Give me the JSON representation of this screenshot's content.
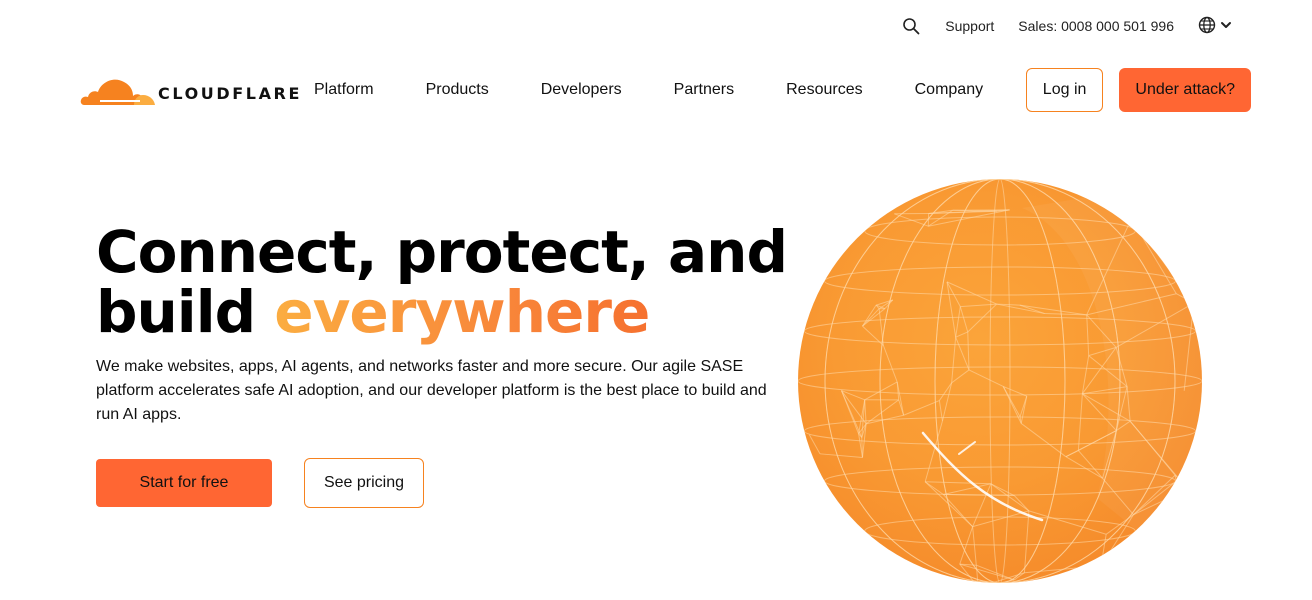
{
  "utility": {
    "search_icon": "search-icon",
    "support": "Support",
    "sales": "Sales: 0008 000 501 996",
    "language_icon": "globe-icon"
  },
  "brand": {
    "name": "CLOUDFLARE",
    "colors": {
      "orange_dark": "#f6821f",
      "orange_light": "#fbad41",
      "cta": "#ff6633"
    }
  },
  "nav": {
    "items": [
      "Platform",
      "Products",
      "Developers",
      "Partners",
      "Resources",
      "Company"
    ],
    "login": "Log in",
    "attack": "Under attack?"
  },
  "hero": {
    "title_line1": "Connect, protect, and",
    "title_line2_plain": "build ",
    "title_line2_accent": "everywhere",
    "description": "We make websites, apps, AI agents, and networks faster and more secure. Our agile SASE platform accelerates safe AI adoption, and our developer platform is the best place to build and run AI apps.",
    "primary_cta": "Start for free",
    "secondary_cta": "See pricing"
  }
}
